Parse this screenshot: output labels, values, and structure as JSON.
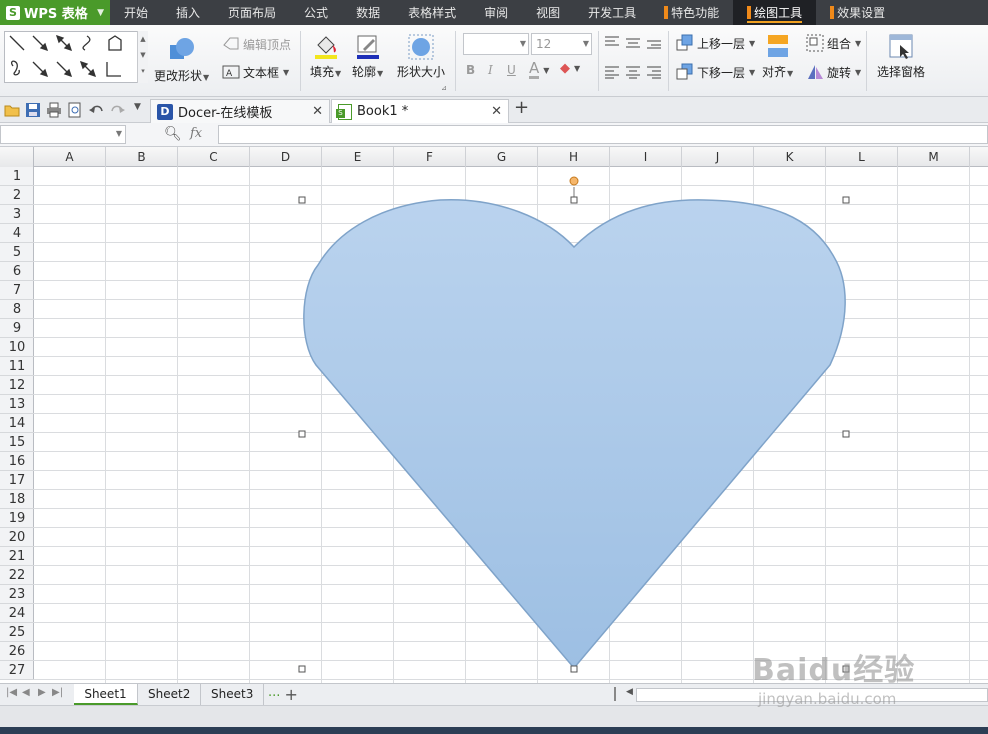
{
  "app": {
    "name": "WPS 表格",
    "logo": "S"
  },
  "menu": {
    "tabs": [
      {
        "label": "开始"
      },
      {
        "label": "插入"
      },
      {
        "label": "页面布局"
      },
      {
        "label": "公式"
      },
      {
        "label": "数据"
      },
      {
        "label": "表格样式"
      },
      {
        "label": "审阅"
      },
      {
        "label": "视图"
      },
      {
        "label": "开发工具"
      },
      {
        "label": "特色功能"
      },
      {
        "label": "绘图工具"
      },
      {
        "label": "效果设置"
      }
    ],
    "active": "绘图工具"
  },
  "ribbon": {
    "change_shape": "更改形状",
    "edit_vertex": "编辑顶点",
    "text_box": "文本框",
    "fill": "填充",
    "outline": "轮廓",
    "shape_size": "形状大小",
    "font_size": "12",
    "bring_forward": "上移一层",
    "send_backward": "下移一层",
    "align": "对齐",
    "group": "组合",
    "rotate": "旋转",
    "selection_pane": "选择窗格"
  },
  "tabs": {
    "docer": "Docer-在线模板",
    "book": "Book1 *"
  },
  "formula": {
    "fx": "fx"
  },
  "grid": {
    "columns": [
      "A",
      "B",
      "C",
      "D",
      "E",
      "F",
      "G",
      "H",
      "I",
      "J",
      "K",
      "L",
      "M"
    ],
    "rows": [
      "1",
      "2",
      "3",
      "4",
      "5",
      "6",
      "7",
      "8",
      "9",
      "10",
      "11",
      "12",
      "13",
      "14",
      "15",
      "16",
      "17",
      "18",
      "19",
      "20",
      "21",
      "22",
      "23",
      "24",
      "25",
      "26",
      "27"
    ]
  },
  "shape": {
    "type": "heart",
    "fill_top": "#bad3ee",
    "fill_bottom": "#9dbfe3",
    "stroke": "#7fa3c9"
  },
  "sheets": {
    "tabs": [
      "Sheet1",
      "Sheet2",
      "Sheet3"
    ],
    "active": "Sheet1",
    "more": "···"
  },
  "watermark": {
    "main": "Baidu经验",
    "sub": "jingyan.baidu.com"
  },
  "icons": [
    "wps-logo-icon",
    "folder-icon",
    "save-icon",
    "print-icon",
    "preview-icon",
    "undo-icon",
    "redo-icon",
    "zoom-icon",
    "docer-icon",
    "excel-icon"
  ]
}
